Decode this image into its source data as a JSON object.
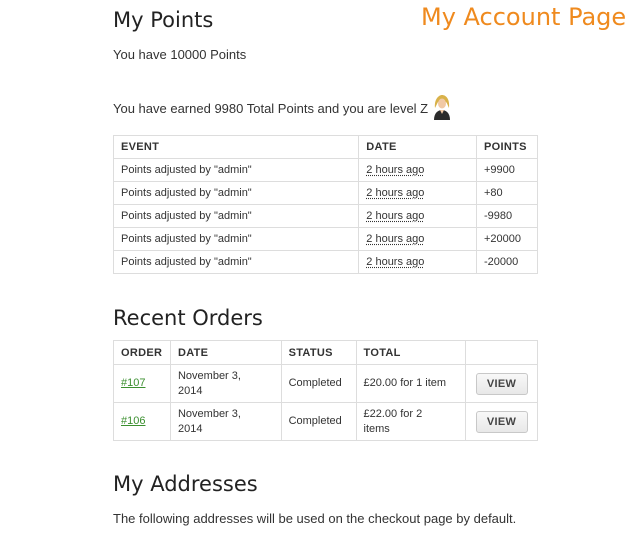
{
  "overlay_title": "My Account Page",
  "points": {
    "heading": "My Points",
    "balance_text": "You have 10000 Points",
    "earned_text": "You have earned 9980 Total Points and you are level Z",
    "table": {
      "headers": [
        "EVENT",
        "DATE",
        "POINTS"
      ],
      "rows": [
        {
          "event": "Points adjusted by \"admin\"",
          "date": "2 hours ago",
          "points": "+9900"
        },
        {
          "event": "Points adjusted by \"admin\"",
          "date": "2 hours ago",
          "points": "+80"
        },
        {
          "event": "Points adjusted by \"admin\"",
          "date": "2 hours ago",
          "points": "-9980"
        },
        {
          "event": "Points adjusted by \"admin\"",
          "date": "2 hours ago",
          "points": "+20000"
        },
        {
          "event": "Points adjusted by \"admin\"",
          "date": "2 hours ago",
          "points": "-20000"
        }
      ]
    }
  },
  "orders": {
    "heading": "Recent Orders",
    "headers": [
      "ORDER",
      "DATE",
      "STATUS",
      "TOTAL",
      ""
    ],
    "rows": [
      {
        "order": "#107",
        "date_line1": "November 3,",
        "date_line2": "2014",
        "status": "Completed",
        "total_line1": "£20.00 for 1 item",
        "total_line2": "",
        "action": "VIEW"
      },
      {
        "order": "#106",
        "date_line1": "November 3,",
        "date_line2": "2014",
        "status": "Completed",
        "total_line1": "£22.00 for 2",
        "total_line2": "items",
        "action": "VIEW"
      }
    ]
  },
  "addresses": {
    "heading": "My Addresses",
    "description": "The following addresses will be used on the checkout page by default."
  },
  "colors": {
    "overlay_title": "#ef8a1e",
    "order_link": "#3b8f2f"
  }
}
